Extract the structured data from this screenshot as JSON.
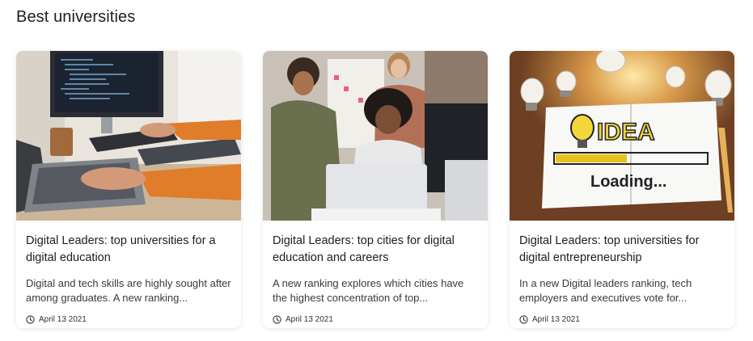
{
  "section": {
    "title": "Best universities"
  },
  "cards": [
    {
      "title": "Digital Leaders: top universities for a digital education",
      "excerpt": "Digital and tech skills are highly sought after among graduates. A new ranking...",
      "date": "April 13 2021",
      "image_icon": "laptop-coding-photo"
    },
    {
      "title": "Digital Leaders: top cities for digital education and careers",
      "excerpt": "A new ranking explores which cities have the highest concentration of top...",
      "date": "April 13 2021",
      "image_icon": "students-at-computer-photo"
    },
    {
      "title": "Digital Leaders: top universities for digital entrepreneurship",
      "excerpt": "In a new Digital leaders ranking, tech employers and executives vote for...",
      "date": "April 13 2021",
      "image_icon": "idea-loading-notebook-photo",
      "image_text_main": "IDEA",
      "image_text_sub": "Loading..."
    }
  ]
}
